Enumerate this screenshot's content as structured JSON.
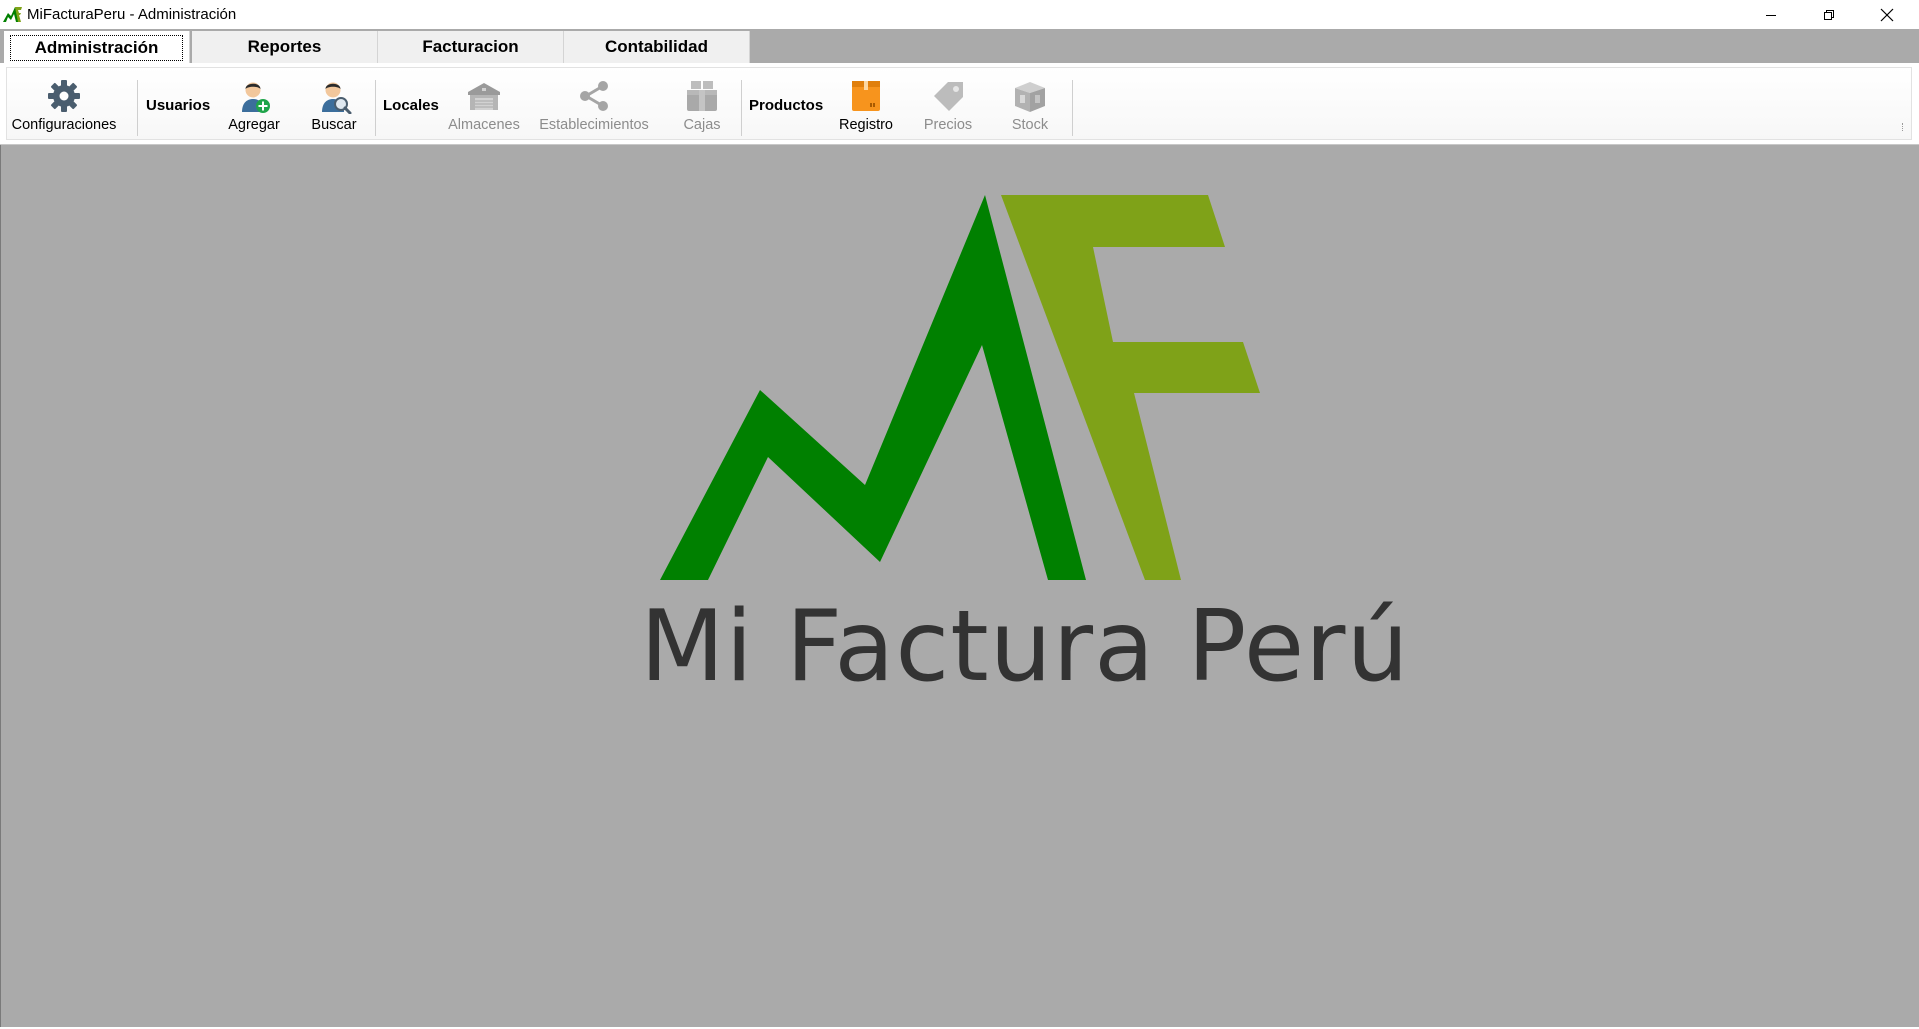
{
  "window": {
    "title": "MiFacturaPeru - Administración",
    "controls": [
      "minimize-icon",
      "restore-icon",
      "close-icon"
    ]
  },
  "tabs": [
    {
      "label": "Administración",
      "active": true
    },
    {
      "label": "Reportes",
      "active": false
    },
    {
      "label": "Facturacion",
      "active": false
    },
    {
      "label": "Contabilidad",
      "active": false
    }
  ],
  "toolbar": {
    "configuraciones": {
      "label": "Configuraciones",
      "icon": "gear-icon",
      "enabled": true
    },
    "usuarios_group": "Usuarios",
    "agregar": {
      "label": "Agregar",
      "icon": "add-user-icon",
      "enabled": true
    },
    "buscar": {
      "label": "Buscar",
      "icon": "search-user-icon",
      "enabled": true
    },
    "locales_group": "Locales",
    "almacenes": {
      "label": "Almacenes",
      "icon": "warehouse-icon",
      "enabled": false
    },
    "establecimientos": {
      "label": "Establecimientos",
      "icon": "share-nodes-icon",
      "enabled": false
    },
    "cajas": {
      "label": "Cajas",
      "icon": "boxes-icon",
      "enabled": false
    },
    "productos_group": "Productos",
    "registro": {
      "label": "Registro",
      "icon": "package-icon",
      "enabled": true
    },
    "precios": {
      "label": "Precios",
      "icon": "price-tag-icon",
      "enabled": false
    },
    "stock": {
      "label": "Stock",
      "icon": "stock-box-icon",
      "enabled": false
    }
  },
  "main": {
    "logo_text": "Mi Factura Perú"
  },
  "colors": {
    "logo_dark_green": "#008000",
    "logo_light_green": "#7fa218",
    "workspace_gray": "#aaaaaa",
    "registro_orange": "#f7941d",
    "icon_slate": "#4a5d6e"
  }
}
